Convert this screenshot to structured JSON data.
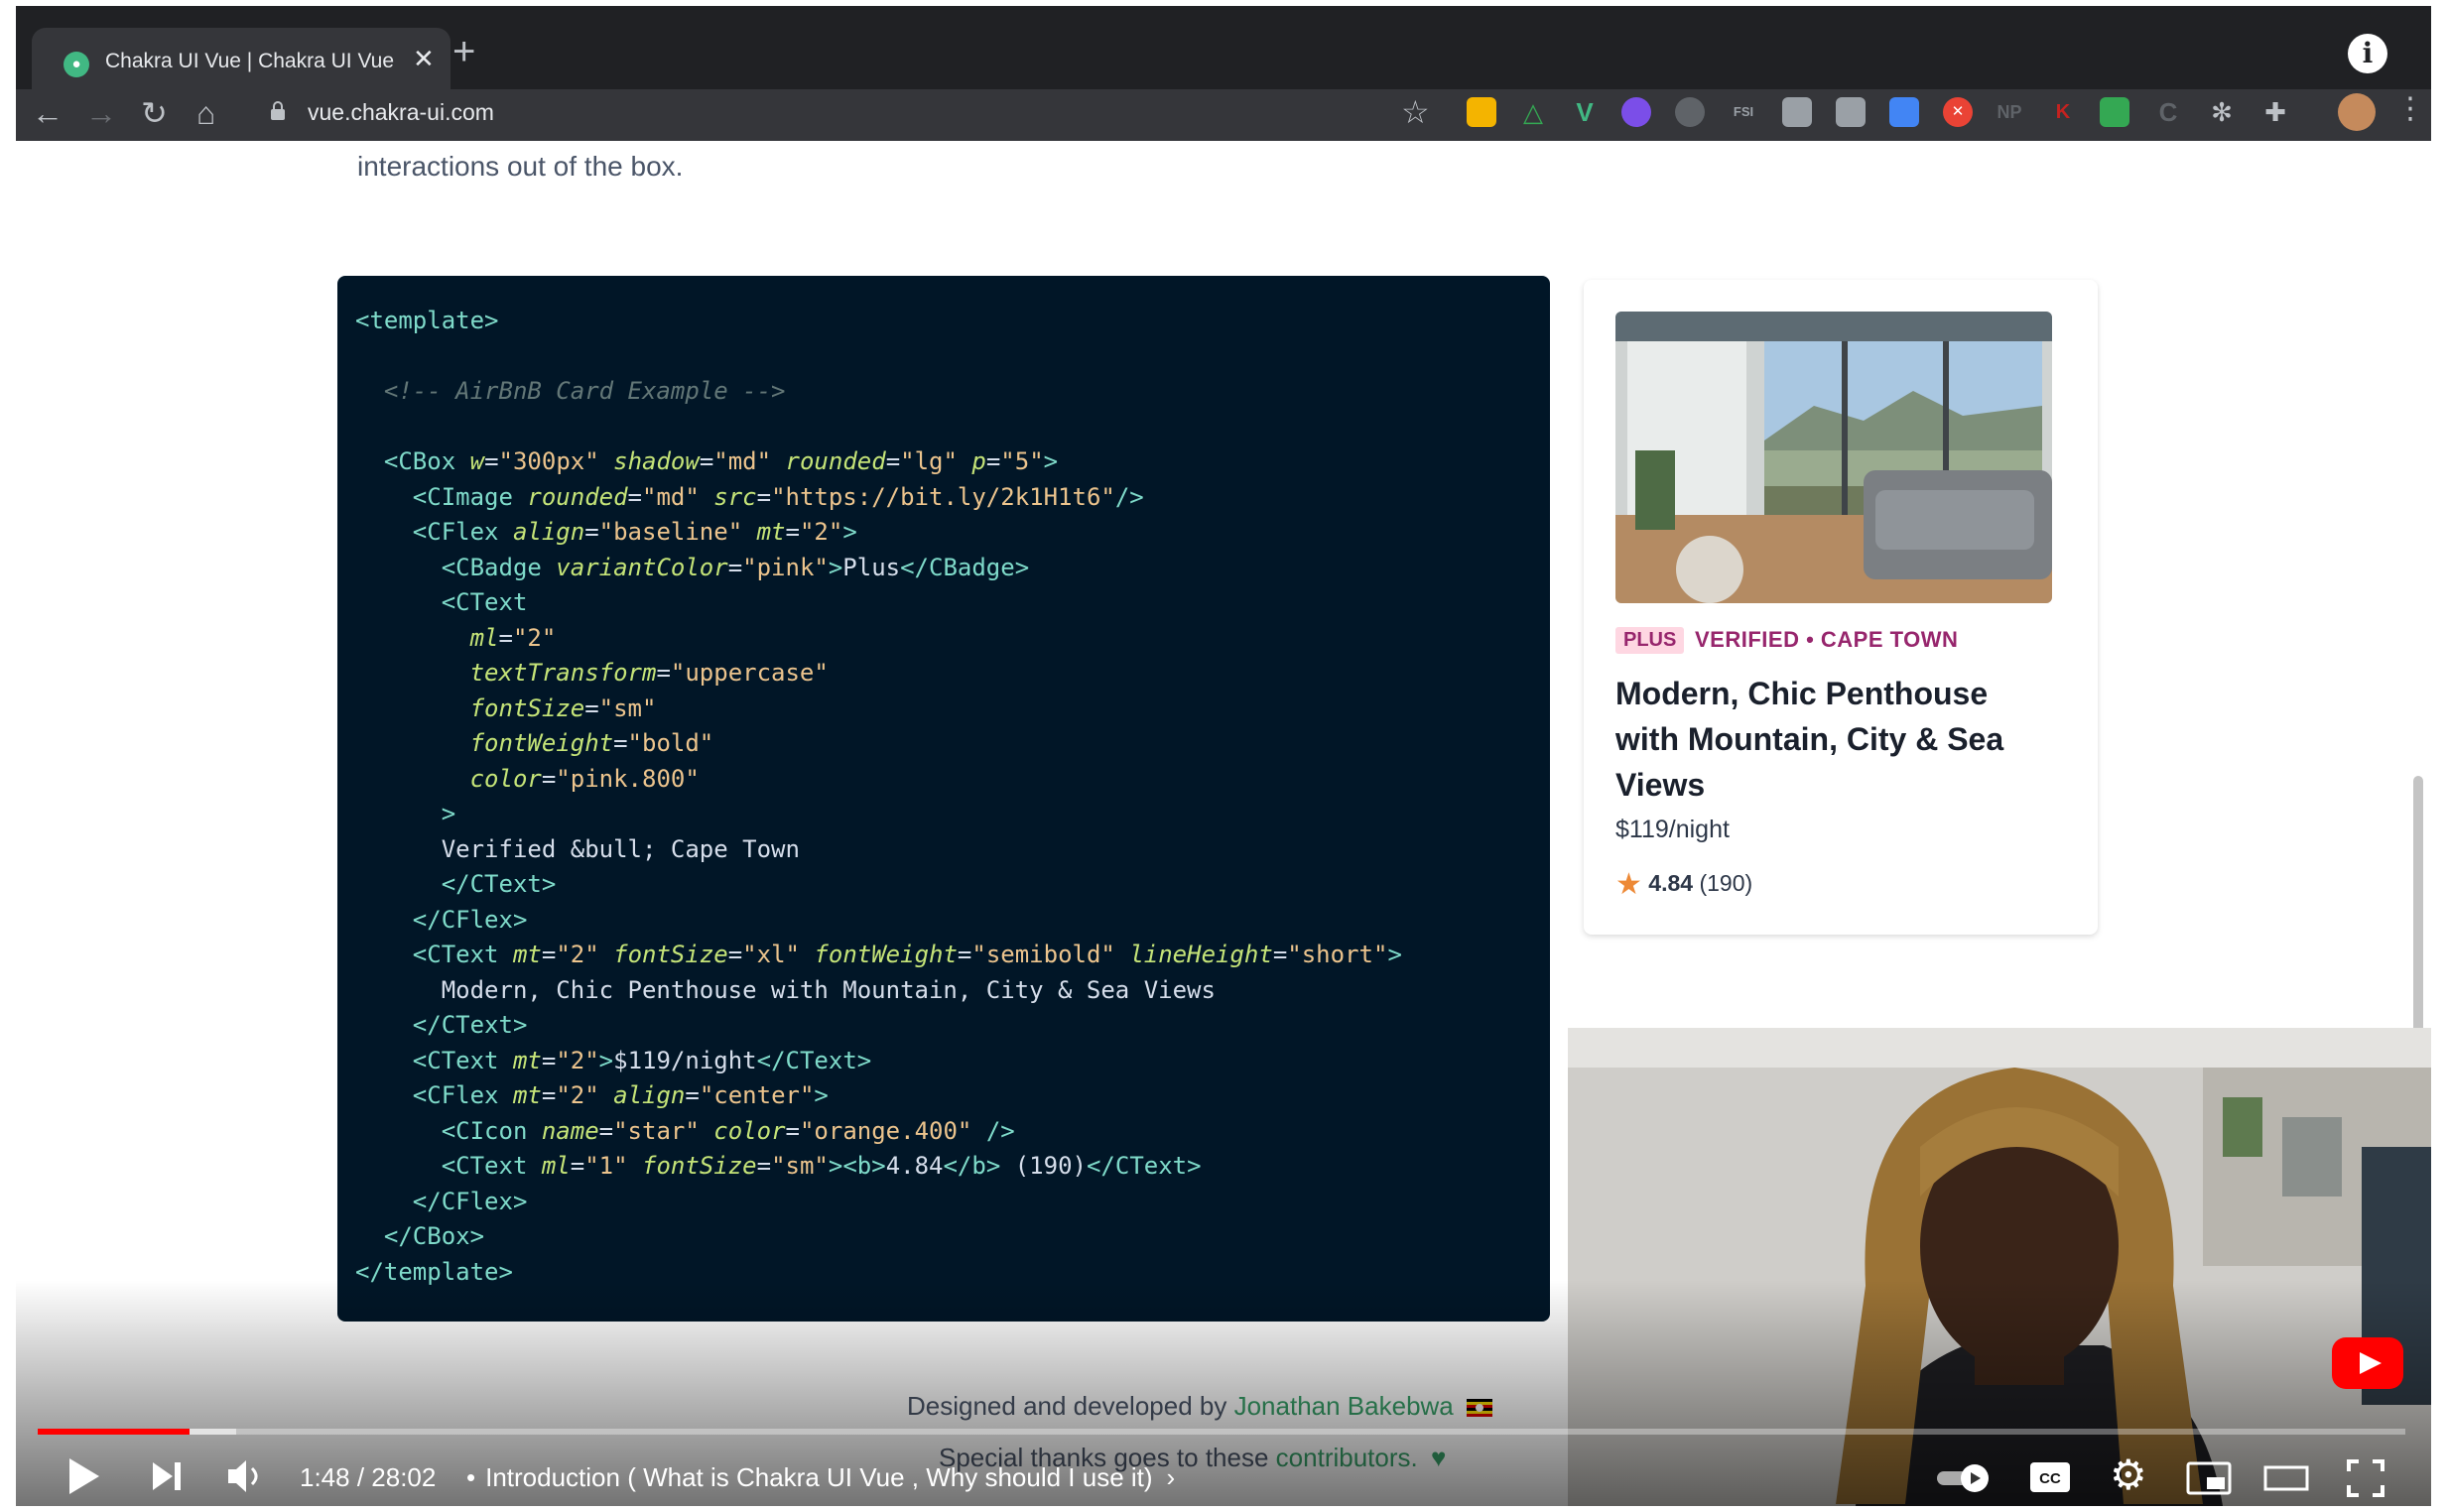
{
  "browser": {
    "tab_title": "Chakra UI Vue | Chakra UI Vue",
    "favicon_text": "●",
    "url": "vue.chakra-ui.com",
    "info_glyph": "i"
  },
  "page": {
    "intro_text": "interactions out of the box.",
    "code_lines": [
      [
        [
          "t",
          "<template>"
        ]
      ],
      [],
      [
        [
          "c",
          "  <!-- AirBnB Card Example -->"
        ]
      ],
      [],
      [
        [
          "p",
          "  "
        ],
        [
          "t",
          "<CBox "
        ],
        [
          "a",
          "w"
        ],
        [
          "p",
          "="
        ],
        [
          "s",
          "\"300px\""
        ],
        [
          "p",
          " "
        ],
        [
          "a",
          "shadow"
        ],
        [
          "p",
          "="
        ],
        [
          "s",
          "\"md\""
        ],
        [
          "p",
          " "
        ],
        [
          "a",
          "rounded"
        ],
        [
          "p",
          "="
        ],
        [
          "s",
          "\"lg\""
        ],
        [
          "p",
          " "
        ],
        [
          "a",
          "p"
        ],
        [
          "p",
          "="
        ],
        [
          "s",
          "\"5\""
        ],
        [
          "t",
          ">"
        ]
      ],
      [
        [
          "p",
          "    "
        ],
        [
          "t",
          "<CImage "
        ],
        [
          "a",
          "rounded"
        ],
        [
          "p",
          "="
        ],
        [
          "s",
          "\"md\""
        ],
        [
          "p",
          " "
        ],
        [
          "a",
          "src"
        ],
        [
          "p",
          "="
        ],
        [
          "s",
          "\"https://bit.ly/2k1H1t6\""
        ],
        [
          "t",
          "/>"
        ]
      ],
      [
        [
          "p",
          "    "
        ],
        [
          "t",
          "<CFlex "
        ],
        [
          "a",
          "align"
        ],
        [
          "p",
          "="
        ],
        [
          "s",
          "\"baseline\""
        ],
        [
          "p",
          " "
        ],
        [
          "a",
          "mt"
        ],
        [
          "p",
          "="
        ],
        [
          "s",
          "\"2\""
        ],
        [
          "t",
          ">"
        ]
      ],
      [
        [
          "p",
          "      "
        ],
        [
          "t",
          "<CBadge "
        ],
        [
          "a",
          "variantColor"
        ],
        [
          "p",
          "="
        ],
        [
          "s",
          "\"pink\""
        ],
        [
          "t",
          ">"
        ],
        [
          "p",
          "Plus"
        ],
        [
          "t",
          "</CBadge>"
        ]
      ],
      [
        [
          "p",
          "      "
        ],
        [
          "t",
          "<CText"
        ]
      ],
      [
        [
          "p",
          "        "
        ],
        [
          "a",
          "ml"
        ],
        [
          "p",
          "="
        ],
        [
          "s",
          "\"2\""
        ]
      ],
      [
        [
          "p",
          "        "
        ],
        [
          "a",
          "textTransform"
        ],
        [
          "p",
          "="
        ],
        [
          "s",
          "\"uppercase\""
        ]
      ],
      [
        [
          "p",
          "        "
        ],
        [
          "a",
          "fontSize"
        ],
        [
          "p",
          "="
        ],
        [
          "s",
          "\"sm\""
        ]
      ],
      [
        [
          "p",
          "        "
        ],
        [
          "a",
          "fontWeight"
        ],
        [
          "p",
          "="
        ],
        [
          "s",
          "\"bold\""
        ]
      ],
      [
        [
          "p",
          "        "
        ],
        [
          "a",
          "color"
        ],
        [
          "p",
          "="
        ],
        [
          "s",
          "\"pink.800\""
        ]
      ],
      [
        [
          "p",
          "      "
        ],
        [
          "t",
          ">"
        ]
      ],
      [
        [
          "p",
          "      Verified &bull; Cape Town"
        ]
      ],
      [
        [
          "p",
          "      "
        ],
        [
          "t",
          "</CText>"
        ]
      ],
      [
        [
          "p",
          "    "
        ],
        [
          "t",
          "</CFlex>"
        ]
      ],
      [
        [
          "p",
          "    "
        ],
        [
          "t",
          "<CText "
        ],
        [
          "a",
          "mt"
        ],
        [
          "p",
          "="
        ],
        [
          "s",
          "\"2\""
        ],
        [
          "p",
          " "
        ],
        [
          "a",
          "fontSize"
        ],
        [
          "p",
          "="
        ],
        [
          "s",
          "\"xl\""
        ],
        [
          "p",
          " "
        ],
        [
          "a",
          "fontWeight"
        ],
        [
          "p",
          "="
        ],
        [
          "s",
          "\"semibold\""
        ],
        [
          "p",
          " "
        ],
        [
          "a",
          "lineHeight"
        ],
        [
          "p",
          "="
        ],
        [
          "s",
          "\"short\""
        ],
        [
          "t",
          ">"
        ]
      ],
      [
        [
          "p",
          "      Modern, Chic Penthouse with Mountain, City & Sea Views"
        ]
      ],
      [
        [
          "p",
          "    "
        ],
        [
          "t",
          "</CText>"
        ]
      ],
      [
        [
          "p",
          "    "
        ],
        [
          "t",
          "<CText "
        ],
        [
          "a",
          "mt"
        ],
        [
          "p",
          "="
        ],
        [
          "s",
          "\"2\""
        ],
        [
          "t",
          ">"
        ],
        [
          "p",
          "$119/night"
        ],
        [
          "t",
          "</CText>"
        ]
      ],
      [
        [
          "p",
          "    "
        ],
        [
          "t",
          "<CFlex "
        ],
        [
          "a",
          "mt"
        ],
        [
          "p",
          "="
        ],
        [
          "s",
          "\"2\""
        ],
        [
          "p",
          " "
        ],
        [
          "a",
          "align"
        ],
        [
          "p",
          "="
        ],
        [
          "s",
          "\"center\""
        ],
        [
          "t",
          ">"
        ]
      ],
      [
        [
          "p",
          "      "
        ],
        [
          "t",
          "<CIcon "
        ],
        [
          "a",
          "name"
        ],
        [
          "p",
          "="
        ],
        [
          "s",
          "\"star\""
        ],
        [
          "p",
          " "
        ],
        [
          "a",
          "color"
        ],
        [
          "p",
          "="
        ],
        [
          "s",
          "\"orange.400\""
        ],
        [
          "p",
          " "
        ],
        [
          "t",
          "/>"
        ]
      ],
      [
        [
          "p",
          "      "
        ],
        [
          "t",
          "<CText "
        ],
        [
          "a",
          "ml"
        ],
        [
          "p",
          "="
        ],
        [
          "s",
          "\"1\""
        ],
        [
          "p",
          " "
        ],
        [
          "a",
          "fontSize"
        ],
        [
          "p",
          "="
        ],
        [
          "s",
          "\"sm\""
        ],
        [
          "t",
          ">"
        ],
        [
          "t",
          "<b>"
        ],
        [
          "p",
          "4.84"
        ],
        [
          "t",
          "</b>"
        ],
        [
          "p",
          " (190)"
        ],
        [
          "t",
          "</CText>"
        ]
      ],
      [
        [
          "p",
          "    "
        ],
        [
          "t",
          "</CFlex>"
        ]
      ],
      [
        [
          "p",
          "  "
        ],
        [
          "t",
          "</CBox>"
        ]
      ],
      [
        [
          "t",
          "</template>"
        ]
      ]
    ],
    "card": {
      "badge": "PLUS",
      "meta": "VERIFIED • CAPE TOWN",
      "title": "Modern, Chic Penthouse with Mountain, City & Sea Views",
      "price": "$119/night",
      "rating": "4.84",
      "reviews": "(190)"
    },
    "footer": {
      "designed_prefix": "Designed and developed by ",
      "author": "Jonathan Bakebwa",
      "thanks_prefix": "Special thanks goes to these ",
      "contributors": "contributors."
    }
  },
  "player": {
    "time": "1:48 / 28:02",
    "separator": "•",
    "chapter": "Introduction ( What is Chakra UI Vue , Why should I use it)",
    "progress_fraction": 0.064
  },
  "colors": {
    "code_bg": "#011627",
    "badge_bg": "#fed7e2",
    "badge_text": "#97266d",
    "link_green": "#38a169",
    "progress_red": "#ff0000",
    "star_orange": "#ed8936"
  }
}
